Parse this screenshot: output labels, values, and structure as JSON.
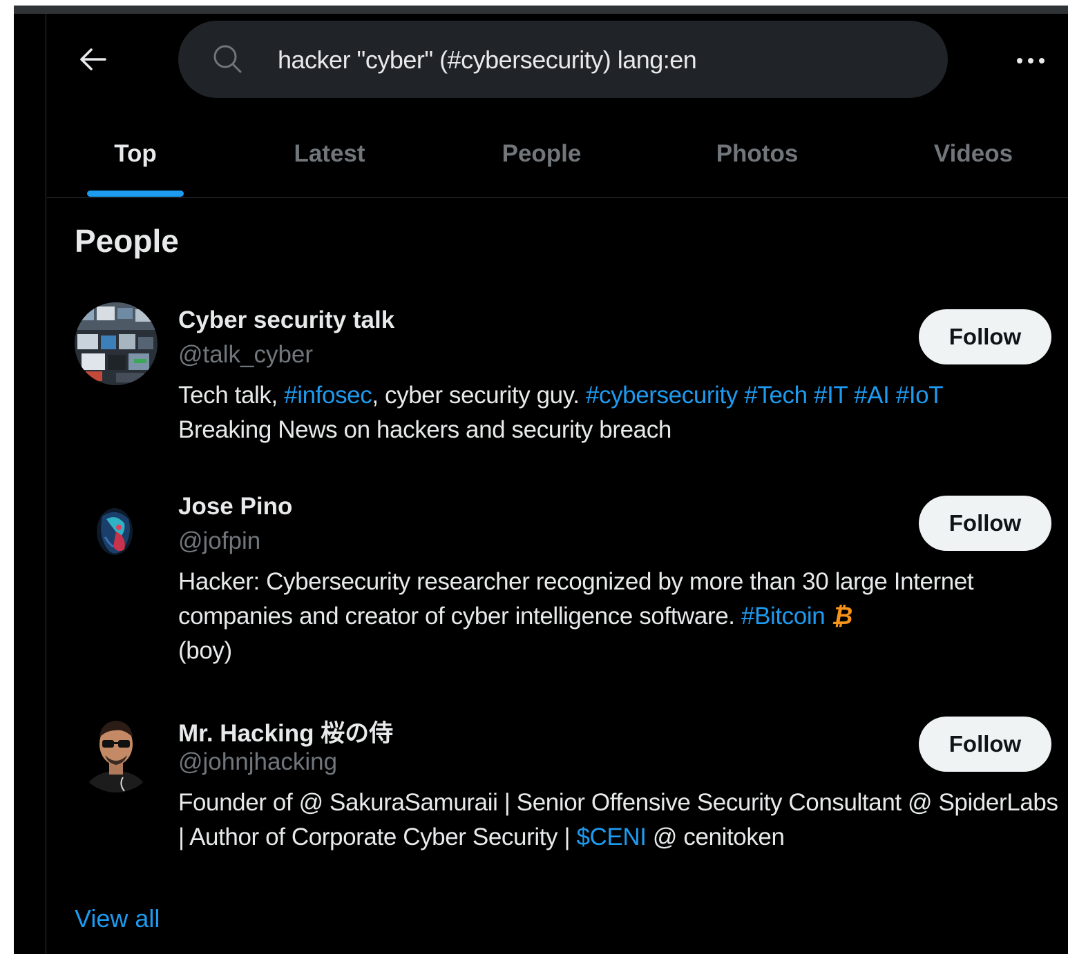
{
  "search": {
    "query": "hacker \"cyber\" (#cybersecurity) lang:en"
  },
  "tabs": [
    {
      "label": "Top",
      "active": true
    },
    {
      "label": "Latest",
      "active": false
    },
    {
      "label": "People",
      "active": false
    },
    {
      "label": "Photos",
      "active": false
    },
    {
      "label": "Videos",
      "active": false
    }
  ],
  "section": {
    "title": "People",
    "view_all": "View all"
  },
  "people": [
    {
      "name": "Cyber security talk",
      "handle": "@talk_cyber",
      "follow_label": "Follow",
      "bio": {
        "p1": "Tech talk, ",
        "t1": "#infosec",
        "p2": ", cyber security guy. ",
        "t2": "#cybersecurity",
        "t3": "#Tech",
        "t4": "#IT",
        "t5": "#AI",
        "t6": "#IoT",
        "p3": "Breaking News on hackers and security breach"
      }
    },
    {
      "name": "Jose Pino",
      "handle": "@jofpin",
      "follow_label": "Follow",
      "bio": {
        "p1": "Hacker: Cybersecurity researcher recognized by more than 30 large Internet companies and creator of cyber intelligence software. ",
        "t1": "#Bitcoin",
        "emoji": "₿",
        "p2": "(boy)"
      }
    },
    {
      "name": "Mr. Hacking 桜の侍",
      "handle": "@johnjhacking",
      "follow_label": "Follow",
      "bio": {
        "p1": "Founder of @ SakuraSamuraii | Senior Offensive Security Consultant @ SpiderLabs | Author of Corporate Cyber Security | ",
        "t1": "$CENI",
        "p2": " @ cenitoken"
      }
    }
  ],
  "colors": {
    "background": "#000000",
    "accent": "#1d9bf0",
    "text_primary": "#e7e9ea",
    "text_secondary": "#71767b",
    "search_bg": "#202327",
    "bitcoin": "#f7931a"
  },
  "icons": {
    "back": "arrow-left-icon",
    "search": "search-icon",
    "more": "more-horizontal-icon"
  }
}
